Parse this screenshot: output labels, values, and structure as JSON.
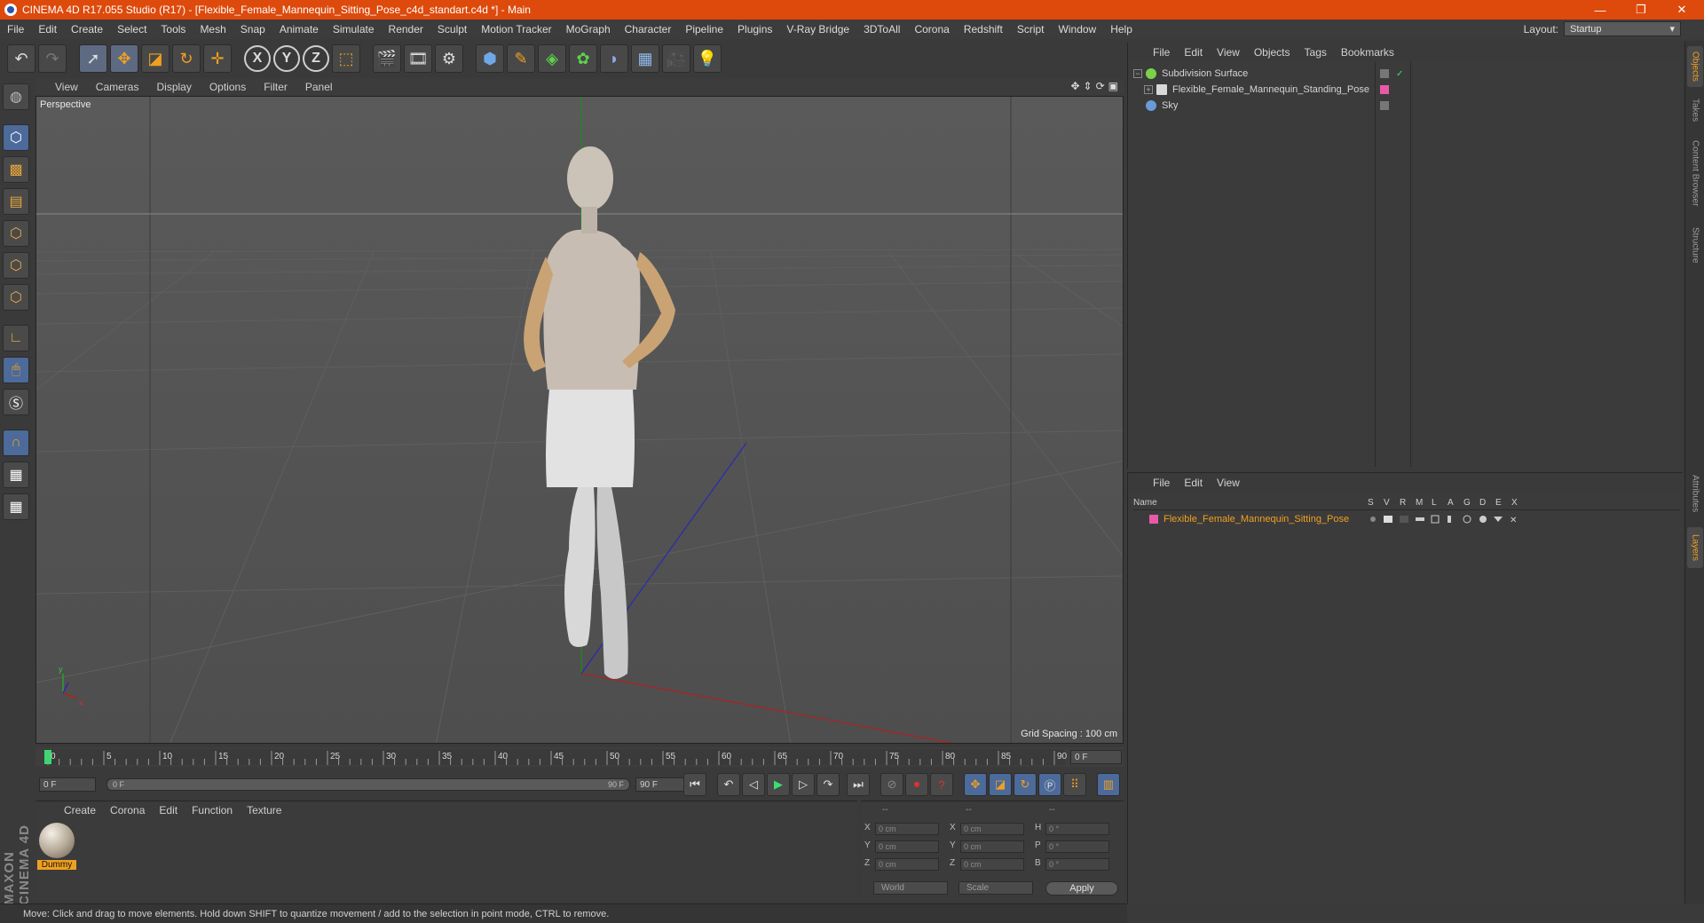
{
  "window": {
    "title": "CINEMA 4D R17.055 Studio (R17) - [Flexible_Female_Mannequin_Sitting_Pose_c4d_standart.c4d *] - Main",
    "minimize": "—",
    "maximize": "❐",
    "close": "✕"
  },
  "menubar": [
    "File",
    "Edit",
    "Create",
    "Select",
    "Tools",
    "Mesh",
    "Snap",
    "Animate",
    "Simulate",
    "Render",
    "Sculpt",
    "Motion Tracker",
    "MoGraph",
    "Character",
    "Pipeline",
    "Plugins",
    "V-Ray Bridge",
    "3DToAll",
    "Corona",
    "Redshift",
    "Script",
    "Window",
    "Help"
  ],
  "layout": {
    "label": "Layout:",
    "value": "Startup"
  },
  "viewport": {
    "menu": [
      "View",
      "Cameras",
      "Display",
      "Options",
      "Filter",
      "Panel"
    ],
    "name": "Perspective",
    "grid_spacing": "Grid Spacing : 100 cm",
    "axis_y": "y",
    "axis_x": "x"
  },
  "timeline": {
    "ticks": [
      "0",
      "5",
      "10",
      "15",
      "20",
      "25",
      "30",
      "35",
      "40",
      "45",
      "50",
      "55",
      "60",
      "65",
      "70",
      "75",
      "80",
      "85",
      "90"
    ],
    "current_frame": "0 F",
    "start_frame": "0 F",
    "range_start": "0 F",
    "range_end": "90 F",
    "end_frame": "90 F"
  },
  "material_panel": {
    "menu": [
      "Create",
      "Corona",
      "Edit",
      "Function",
      "Texture"
    ],
    "material_name": "Dummy"
  },
  "coords": {
    "header": [
      "--",
      "--",
      "--"
    ],
    "rows": [
      {
        "l1": "X",
        "v1": "0 cm",
        "l2": "X",
        "v2": "0 cm",
        "l3": "H",
        "v3": "0 °"
      },
      {
        "l1": "Y",
        "v1": "0 cm",
        "l2": "Y",
        "v2": "0 cm",
        "l3": "P",
        "v3": "0 °"
      },
      {
        "l1": "Z",
        "v1": "0 cm",
        "l2": "Z",
        "v2": "0 cm",
        "l3": "B",
        "v3": "0 °"
      }
    ],
    "space": "World",
    "mode": "Scale",
    "apply": "Apply"
  },
  "status": "Move: Click and drag to move elements. Hold down SHIFT to quantize movement / add to the selection in point mode, CTRL to remove.",
  "objects_panel": {
    "menu": [
      "File",
      "Edit",
      "View",
      "Objects",
      "Tags",
      "Bookmarks"
    ],
    "items": [
      {
        "name": "Subdivision Surface",
        "color": "#7bd24a"
      },
      {
        "name": "Flexible_Female_Mannequin_Standing_Pose",
        "color": "#d8d8d8"
      },
      {
        "name": "Sky",
        "color": "#6a9ad8"
      }
    ]
  },
  "layers_panel": {
    "menu": [
      "File",
      "Edit",
      "View"
    ],
    "columns": [
      "Name",
      "S",
      "V",
      "R",
      "M",
      "L",
      "A",
      "G",
      "D",
      "E",
      "X"
    ],
    "layer_name": "Flexible_Female_Mannequin_Sitting_Pose",
    "layer_color": "#e85aa8"
  },
  "right_tabs": [
    "Objects",
    "Takes",
    "Content Browser",
    "Structure",
    "Attributes",
    "Layers"
  ],
  "brand": "MAXON CINEMA 4D"
}
